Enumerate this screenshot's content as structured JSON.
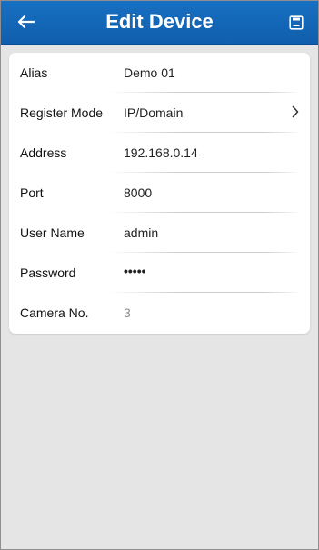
{
  "header": {
    "title": "Edit Device",
    "back_icon": "back-arrow-icon",
    "save_icon": "save-icon"
  },
  "form": {
    "rows": [
      {
        "label": "Alias",
        "value": "Demo 01"
      },
      {
        "label": "Register Mode",
        "value": "IP/Domain",
        "chevron_icon": "chevron-right-icon"
      },
      {
        "label": "Address",
        "value": "192.168.0.14"
      },
      {
        "label": "Port",
        "value": "8000"
      },
      {
        "label": "User Name",
        "value": "admin"
      },
      {
        "label": "Password",
        "value": "•••••"
      },
      {
        "label": "Camera No.",
        "value": "3"
      }
    ]
  },
  "colors": {
    "header_background": "#1368ba",
    "page_background": "#e5e5e5",
    "card_background": "#ffffff",
    "muted_text": "#8a8a8a"
  }
}
